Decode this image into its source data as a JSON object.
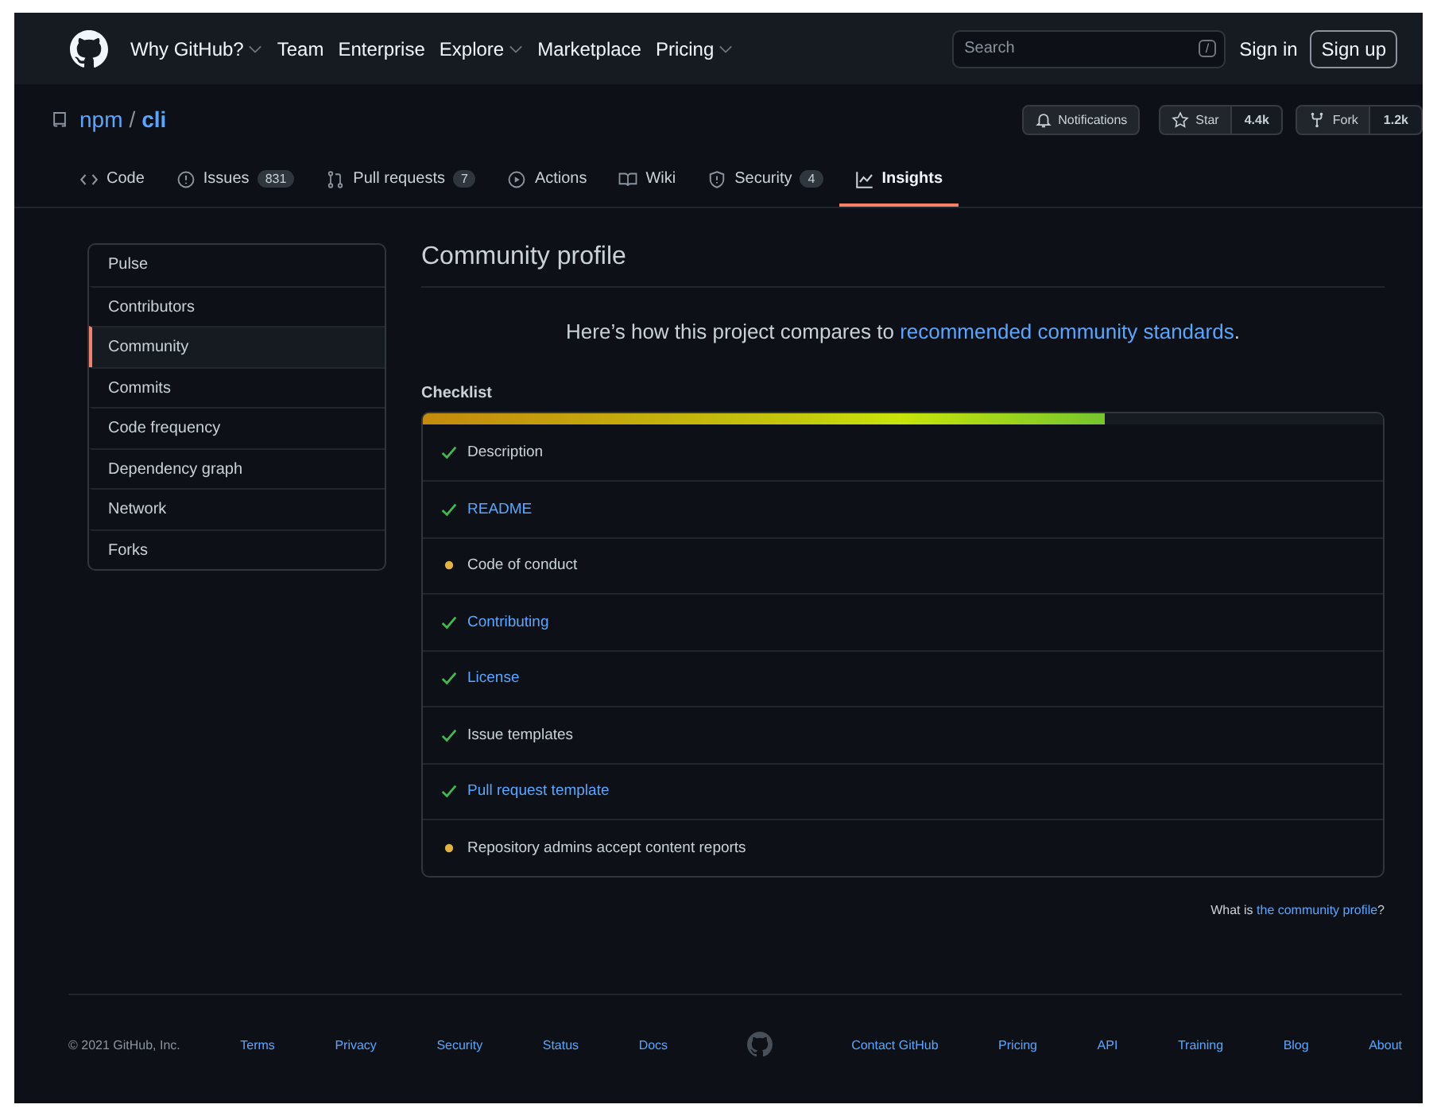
{
  "header": {
    "nav": [
      {
        "label": "Why GitHub?",
        "dropdown": true
      },
      {
        "label": "Team",
        "dropdown": false
      },
      {
        "label": "Enterprise",
        "dropdown": false
      },
      {
        "label": "Explore",
        "dropdown": true
      },
      {
        "label": "Marketplace",
        "dropdown": false
      },
      {
        "label": "Pricing",
        "dropdown": true
      }
    ],
    "search": {
      "placeholder": "Search",
      "key": "/"
    },
    "sign_in": "Sign in",
    "sign_up": "Sign up"
  },
  "repo": {
    "owner": "npm",
    "separator": "/",
    "name": "cli",
    "notifications": "Notifications",
    "star": "Star",
    "star_count": "4.4k",
    "fork": "Fork",
    "fork_count": "1.2k"
  },
  "tabs": [
    {
      "kind": "code",
      "label": "Code",
      "selected": false
    },
    {
      "kind": "issue",
      "label": "Issues",
      "count": "831",
      "selected": false
    },
    {
      "kind": "pr",
      "label": "Pull requests",
      "count": "7",
      "selected": false
    },
    {
      "kind": "play",
      "label": "Actions",
      "selected": false
    },
    {
      "kind": "book",
      "label": "Wiki",
      "selected": false
    },
    {
      "kind": "shield",
      "label": "Security",
      "count": "4",
      "selected": false
    },
    {
      "kind": "graph",
      "label": "Insights",
      "selected": true
    }
  ],
  "sidebar": {
    "items": [
      {
        "label": "Pulse",
        "selected": false
      },
      {
        "label": "Contributors",
        "selected": false
      },
      {
        "label": "Community",
        "selected": true
      },
      {
        "label": "Commits",
        "selected": false
      },
      {
        "label": "Code frequency",
        "selected": false
      },
      {
        "label": "Dependency graph",
        "selected": false
      },
      {
        "label": "Network",
        "selected": false
      },
      {
        "label": "Forks",
        "selected": false
      }
    ]
  },
  "main": {
    "title": "Community profile",
    "intro": "Here’s how this project compares to",
    "intro_link": "recommended community standards",
    "intro_end": ".",
    "checklist_title": "Checklist",
    "level": 0.71,
    "items": [
      {
        "label": "Description",
        "done": true,
        "link": false
      },
      {
        "label": "README",
        "done": true,
        "link": true
      },
      {
        "label": "Code of conduct",
        "done": false,
        "link": false
      },
      {
        "label": "Contributing",
        "done": true,
        "link": true
      },
      {
        "label": "License",
        "done": true,
        "link": true
      },
      {
        "label": "Issue templates",
        "done": true,
        "link": false
      },
      {
        "label": "Pull request template",
        "done": true,
        "link": true
      },
      {
        "label": "Repository admins accept content reports",
        "done": false,
        "link": false
      }
    ],
    "help": "What is",
    "help_link": "the community profile",
    "help_end": "?"
  },
  "footer": {
    "copyright": "© 2021 GitHub, Inc.",
    "left_links": [
      "Terms",
      "Privacy",
      "Security",
      "Status",
      "Docs"
    ],
    "right_links": [
      "Contact GitHub",
      "Pricing",
      "API",
      "Training",
      "Blog",
      "About"
    ]
  }
}
